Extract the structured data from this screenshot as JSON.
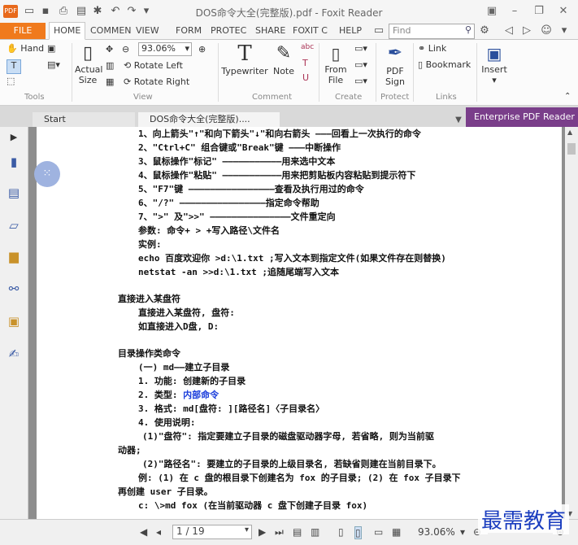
{
  "window": {
    "title": "DOS命令大全(完整版).pdf - Foxit Reader"
  },
  "ribbon_tabs": [
    "FILE",
    "HOME",
    "COMMEN",
    "VIEW",
    "FORM",
    "PROTEC",
    "SHARE",
    "FOXIT C",
    "HELP"
  ],
  "search": {
    "placeholder": "Find"
  },
  "toolbar": {
    "hand": "Hand",
    "actual_size": "Actual Size",
    "zoom": "93.06%",
    "rotate_left": "Rotate Left",
    "rotate_right": "Rotate Right",
    "typewriter": "Typewriter",
    "note": "Note",
    "from_file": "From File",
    "pdf_sign": "PDF Sign",
    "link": "Link",
    "bookmark": "Bookmark",
    "insert": "Insert"
  },
  "groups": {
    "tools": "Tools",
    "view": "View",
    "comment": "Comment",
    "create": "Create",
    "protect": "Protect",
    "links": "Links"
  },
  "doc_tabs": {
    "start": "Start",
    "current": "DOS命令大全(完整版)....",
    "enterprise": "Enterprise PDF Reader"
  },
  "content": [
    "1、向上箭头\"↑\"和向下箭头\"↓\"和向右箭头 ———回看上一次执行的命令",
    "2、\"Ctrl+C\" 组合键或\"Break\"键 ———中断操作",
    "3、鼠标操作\"标记\" ———————————用来选中文本",
    "4、鼠标操作\"粘贴\" ———————————用来把剪贴板内容粘贴到提示符下",
    "5、\"F7\"键 ————————————————查看及执行用过的命令",
    "6、\"/?\" ————————————————指定命令帮助",
    "7、\">\" 及\">>\" ———————————————文件重定向",
    "参数: 命令+ > +写入路径\\文件名",
    "实例:",
    "echo 百度欢迎你 >d:\\1.txt ;写入文本到指定文件(如果文件存在则替换)",
    "netstat -an >>d:\\1.txt ;追随尾端写入文本",
    "直接进入某盘符",
    "直接进入某盘符, 盘符:",
    "如直接进入D盘, D:",
    "目录操作类命令",
    "(一) md——建立子目录",
    "1. 功能: 创建新的子目录",
    "2. 类型: ",
    "内部命令",
    "3. 格式: md[盘符: ][路径名]〈子目录名〉",
    "4. 使用说明:",
    "(1)\"盘符\": 指定要建立子目录的磁盘驱动器字母, 若省略, 则为当前驱",
    "动器;",
    "(2)\"路径名\": 要建立的子目录的上级目录名, 若缺省则建在当前目录下。",
    "例: (1) 在 c 盘的根目录下创建名为 fox 的子目录; (2) 在 fox 子目录下",
    "再创建 user 子目录。",
    "c: \\>md fox  (在当前驱动器 c 盘下创建子目录 fox)"
  ],
  "status": {
    "page": "1 / 19",
    "zoom": "93.06%"
  },
  "watermark": "最需教育"
}
